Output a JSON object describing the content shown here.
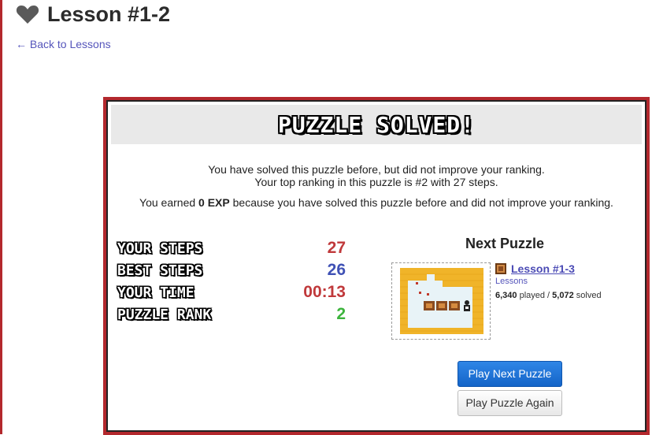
{
  "page": {
    "title": "Lesson #1-2",
    "back_link": "← Back to Lessons"
  },
  "modal": {
    "header": "PUZZLE SOLVED!",
    "message_line1": "You have solved this puzzle before, but did not improve your ranking.",
    "message_line2": "Your top ranking in this puzzle is #2 with 27 steps.",
    "exp_prefix": "You earned ",
    "exp_amount": "0 EXP",
    "exp_suffix": " because you have solved this puzzle before and did not improve your ranking.",
    "stats": [
      {
        "label": "YOUR STEPS",
        "value": "27",
        "color": "#c0393b"
      },
      {
        "label": "BEST STEPS",
        "value": "26",
        "color": "#3f51b5"
      },
      {
        "label": "YOUR TIME",
        "value": "00:13",
        "color": "#c0393b"
      },
      {
        "label": "PUZZLE RANK",
        "value": "2",
        "color": "#3cb43c"
      }
    ],
    "next": {
      "title": "Next Puzzle",
      "lesson_name": "Lesson #1-3",
      "category": "Lessons",
      "played": "6,340",
      "played_label": " played / ",
      "solved": "5,072",
      "solved_label": " solved"
    },
    "buttons": {
      "play_next": "Play Next Puzzle",
      "play_again": "Play Puzzle Again"
    }
  },
  "colors": {
    "accent_red": "#b3282d",
    "link_blue": "#5555bb",
    "primary_button": "#1a6fd6"
  },
  "icons": [
    "heart-icon",
    "crate-icon"
  ]
}
